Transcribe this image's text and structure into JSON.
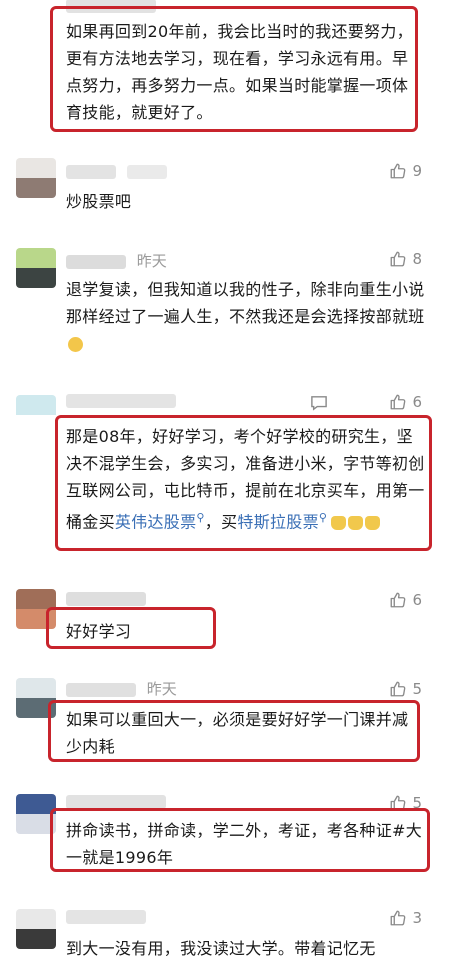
{
  "comments": [
    {
      "meta": "",
      "text": "如果再回到20年前，我会比当时的我还要努力，更有方法地去学习，现在看，学习永远有用。早点努力，再多努力一点。如果当时能掌握一项体育技能，就更好了。",
      "likes": ""
    },
    {
      "meta": "",
      "text": "炒股票吧",
      "likes": "9"
    },
    {
      "meta": "昨天",
      "text": "退学复读，但我知道以我的性子，除非向重生小说那样经过了一遍人生，不然我还是会选择按部就班",
      "likes": "8"
    },
    {
      "meta": "",
      "text_before": "那是08年，好好学习，考个好学校的研究生，坚决不混学生会，多实习，准备进小米，字节等初创互联网公司，屯比特币，提前在北京买车，用第一桶金买",
      "link1": "英伟达股票",
      "text_mid": "，买",
      "link2": "特斯拉股票",
      "likes": "6"
    },
    {
      "meta": "",
      "text": "好好学习",
      "likes": "6"
    },
    {
      "meta": "昨天",
      "text": "如果可以重回大一，必须是要好好学一门课并减少内耗",
      "likes": "5"
    },
    {
      "meta": "",
      "text": "拼命读书，拼命读，学二外，考证，考各种证#大一就是1996年",
      "likes": "5"
    },
    {
      "meta": "",
      "text": "到大一没有用，我没读过大学。带着记忆无",
      "likes": "3"
    }
  ],
  "colors": {
    "highlight_box": "#c8242c",
    "link": "#3a6fb6",
    "meta": "#9a9a9a"
  },
  "icons": {
    "like": "thumbs-up-icon",
    "reply": "comment-icon"
  }
}
